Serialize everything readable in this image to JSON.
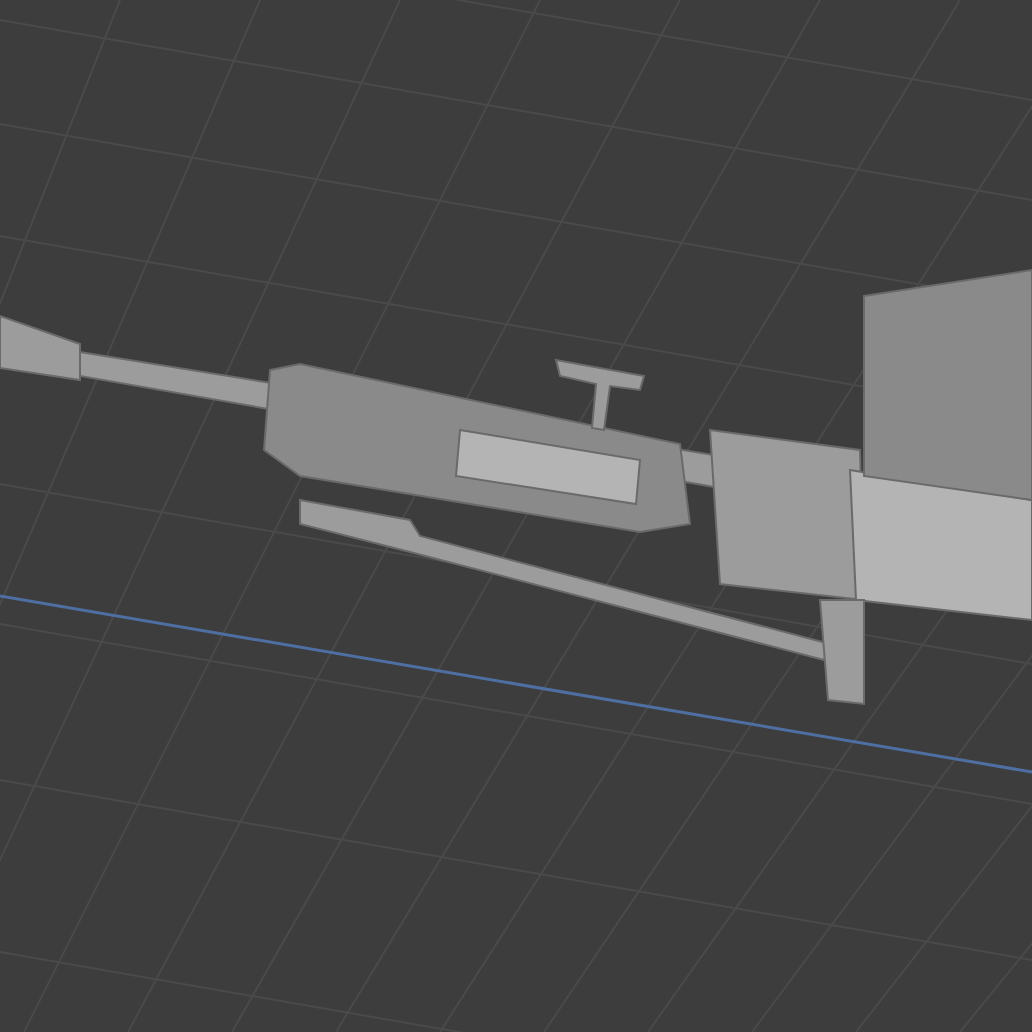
{
  "viewport": {
    "show_grid": true,
    "show_axis": true,
    "show_model": true
  }
}
